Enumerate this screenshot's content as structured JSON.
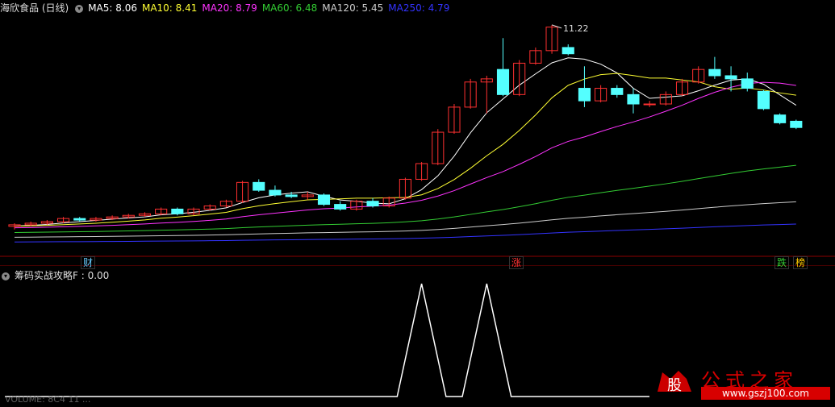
{
  "main_header": {
    "stock": "海欣食品 (日线)",
    "indicators": [
      {
        "label": "MA5: 8.06",
        "color": "#ffffff"
      },
      {
        "label": "MA10: 8.41",
        "color": "#ffff33"
      },
      {
        "label": "MA20: 8.79",
        "color": "#ff33ff"
      },
      {
        "label": "MA60: 6.48",
        "color": "#33cc33"
      },
      {
        "label": "MA120: 5.45",
        "color": "#cccccc"
      },
      {
        "label": "MA250: 4.79",
        "color": "#3333ff"
      }
    ]
  },
  "sub_header": {
    "label": "筹码实战攻略F : 0.00"
  },
  "bottom_partial_text": "VOLUME: 8C4 11 ...",
  "markers": [
    {
      "text": "财",
      "color": "#66ccff"
    },
    {
      "text": "涨",
      "color": "#ff3333"
    },
    {
      "text": "跌",
      "color": "#33cc33"
    },
    {
      "text": "榜",
      "color": "#ffcc00"
    }
  ],
  "watermark": {
    "brand": "公式之家",
    "url": "www.gszj100.com",
    "logo_text": "股"
  },
  "chart_data": {
    "type": "candlestick",
    "y_range": [
      4.0,
      11.5
    ],
    "peak_label": "11.22",
    "candles": [
      [
        4.8,
        4.85,
        4.7,
        4.9
      ],
      [
        4.85,
        4.9,
        4.8,
        4.95
      ],
      [
        4.9,
        4.95,
        4.85,
        5.0
      ],
      [
        4.95,
        5.05,
        4.9,
        5.1
      ],
      [
        5.05,
        5.0,
        4.95,
        5.1
      ],
      [
        5.0,
        5.05,
        4.95,
        5.1
      ],
      [
        5.05,
        5.1,
        5.0,
        5.15
      ],
      [
        5.1,
        5.15,
        5.05,
        5.2
      ],
      [
        5.15,
        5.2,
        5.1,
        5.25
      ],
      [
        5.2,
        5.35,
        5.15,
        5.4
      ],
      [
        5.35,
        5.2,
        5.15,
        5.4
      ],
      [
        5.2,
        5.35,
        5.15,
        5.4
      ],
      [
        5.35,
        5.45,
        5.3,
        5.5
      ],
      [
        5.45,
        5.6,
        5.4,
        5.65
      ],
      [
        5.6,
        6.2,
        5.55,
        6.25
      ],
      [
        6.2,
        5.95,
        5.9,
        6.3
      ],
      [
        5.95,
        5.8,
        5.75,
        6.1
      ],
      [
        5.8,
        5.75,
        5.7,
        5.9
      ],
      [
        5.75,
        5.8,
        5.65,
        5.9
      ],
      [
        5.8,
        5.5,
        5.45,
        5.85
      ],
      [
        5.5,
        5.35,
        5.3,
        5.6
      ],
      [
        5.35,
        5.6,
        5.3,
        5.65
      ],
      [
        5.6,
        5.45,
        5.4,
        5.7
      ],
      [
        5.45,
        5.7,
        5.4,
        5.75
      ],
      [
        5.7,
        6.3,
        5.65,
        6.35
      ],
      [
        6.3,
        6.8,
        6.25,
        6.85
      ],
      [
        6.8,
        7.8,
        6.75,
        7.9
      ],
      [
        7.8,
        8.6,
        7.75,
        8.7
      ],
      [
        8.6,
        9.4,
        8.55,
        9.5
      ],
      [
        9.4,
        9.5,
        8.4,
        9.6
      ],
      [
        9.8,
        9.0,
        8.95,
        10.8
      ],
      [
        9.0,
        10.0,
        8.95,
        10.1
      ],
      [
        10.0,
        10.4,
        9.95,
        10.5
      ],
      [
        10.4,
        11.15,
        10.3,
        11.22
      ],
      [
        10.5,
        10.3,
        10.25,
        10.6
      ],
      [
        9.2,
        8.8,
        8.6,
        9.9
      ],
      [
        8.8,
        9.2,
        8.75,
        9.3
      ],
      [
        9.2,
        9.0,
        8.9,
        9.3
      ],
      [
        9.0,
        8.7,
        8.4,
        9.2
      ],
      [
        8.7,
        8.7,
        8.6,
        8.8
      ],
      [
        8.7,
        9.0,
        8.65,
        9.1
      ],
      [
        9.0,
        9.4,
        8.95,
        9.5
      ],
      [
        9.4,
        9.8,
        9.35,
        9.9
      ],
      [
        9.8,
        9.6,
        9.5,
        10.2
      ],
      [
        9.6,
        9.5,
        9.1,
        9.9
      ],
      [
        9.5,
        9.2,
        9.1,
        9.7
      ],
      [
        9.1,
        8.55,
        8.5,
        9.15
      ],
      [
        8.35,
        8.1,
        8.05,
        8.4
      ],
      [
        8.15,
        7.95,
        7.9,
        8.2
      ]
    ],
    "ma_series": [
      {
        "name": "MA5",
        "color": "#ffffff"
      },
      {
        "name": "MA10",
        "color": "#ffff33"
      },
      {
        "name": "MA20",
        "color": "#ff33ff"
      },
      {
        "name": "MA60",
        "color": "#33cc33"
      },
      {
        "name": "MA120",
        "color": "#cccccc"
      },
      {
        "name": "MA250",
        "color": "#3333ff"
      }
    ],
    "sub_signal": {
      "name": "筹码实战攻略F",
      "peaks_at_candle": [
        25,
        29
      ],
      "peak_value": 1.0
    }
  }
}
